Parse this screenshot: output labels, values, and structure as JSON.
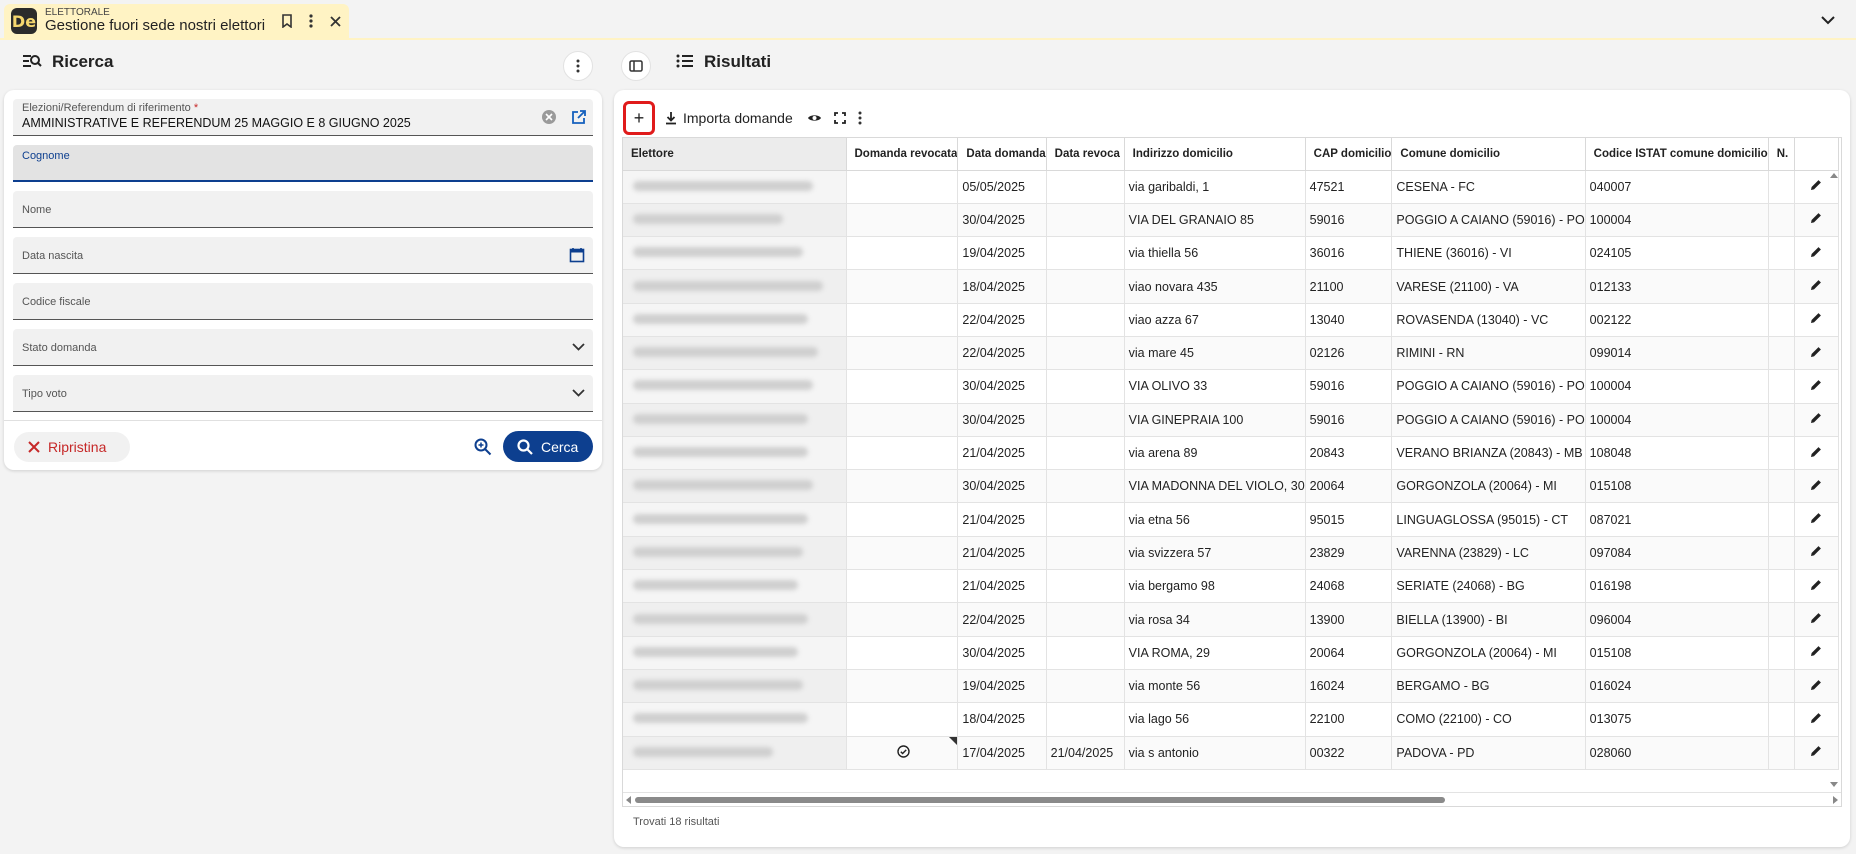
{
  "app": {
    "category": "ELETTORALE",
    "title": "Gestione fuori sede nostri elettori",
    "logo_text": "De"
  },
  "search_panel": {
    "title": "Ricerca",
    "fields": {
      "election": {
        "label": "Elezioni/Referendum di riferimento",
        "required_mark": "*",
        "value": "AMMINISTRATIVE E REFERENDUM 25 MAGGIO E 8 GIUGNO 2025"
      },
      "surname": {
        "label": "Cognome",
        "value": ""
      },
      "name": {
        "label": "Nome",
        "value": ""
      },
      "birth_date": {
        "label": "Data nascita",
        "value": ""
      },
      "tax_code": {
        "label": "Codice fiscale",
        "value": ""
      },
      "status": {
        "label": "Stato domanda",
        "value": ""
      },
      "vote_type": {
        "label": "Tipo voto",
        "value": ""
      }
    },
    "reset_label": "Ripristina",
    "search_label": "Cerca"
  },
  "results_panel": {
    "title": "Risultati",
    "toolbar": {
      "add": "+",
      "import_label": "Importa domande"
    },
    "columns": [
      "Elettore",
      "Domanda revocata",
      "Data domanda",
      "Data revoca",
      "Indirizzo domicilio",
      "CAP domicilio",
      "Comune domicilio",
      "Codice ISTAT comune domicilio",
      "N."
    ],
    "rows": [
      {
        "revoked": false,
        "date": "05/05/2025",
        "revoke_date": "",
        "address": "via garibaldi, 1",
        "cap": "47521",
        "city": "CESENA - FC",
        "istat": "040007"
      },
      {
        "revoked": false,
        "date": "30/04/2025",
        "revoke_date": "",
        "address": "VIA DEL GRANAIO 85",
        "cap": "59016",
        "city": "POGGIO A CAIANO (59016) - PO",
        "istat": "100004"
      },
      {
        "revoked": false,
        "date": "19/04/2025",
        "revoke_date": "",
        "address": "via thiella 56",
        "cap": "36016",
        "city": "THIENE (36016) - VI",
        "istat": "024105"
      },
      {
        "revoked": false,
        "date": "18/04/2025",
        "revoke_date": "",
        "address": "viao novara 435",
        "cap": "21100",
        "city": "VARESE (21100) - VA",
        "istat": "012133"
      },
      {
        "revoked": false,
        "date": "22/04/2025",
        "revoke_date": "",
        "address": "viao azza 67",
        "cap": "13040",
        "city": "ROVASENDA (13040) - VC",
        "istat": "002122"
      },
      {
        "revoked": false,
        "date": "22/04/2025",
        "revoke_date": "",
        "address": "via mare 45",
        "cap": "02126",
        "city": "RIMINI - RN",
        "istat": "099014"
      },
      {
        "revoked": false,
        "date": "30/04/2025",
        "revoke_date": "",
        "address": "VIA OLIVO 33",
        "cap": "59016",
        "city": "POGGIO A CAIANO (59016) - PO",
        "istat": "100004"
      },
      {
        "revoked": false,
        "date": "30/04/2025",
        "revoke_date": "",
        "address": "VIA GINEPRAIA 100",
        "cap": "59016",
        "city": "POGGIO A CAIANO (59016) - PO",
        "istat": "100004"
      },
      {
        "revoked": false,
        "date": "21/04/2025",
        "revoke_date": "",
        "address": "via arena 89",
        "cap": "20843",
        "city": "VERANO BRIANZA (20843) - MB",
        "istat": "108048"
      },
      {
        "revoked": false,
        "date": "30/04/2025",
        "revoke_date": "",
        "address": "VIA MADONNA DEL VIOLO, 30",
        "cap": "20064",
        "city": "GORGONZOLA (20064) - MI",
        "istat": "015108"
      },
      {
        "revoked": false,
        "date": "21/04/2025",
        "revoke_date": "",
        "address": "via etna 56",
        "cap": "95015",
        "city": "LINGUAGLOSSA (95015) - CT",
        "istat": "087021"
      },
      {
        "revoked": false,
        "date": "21/04/2025",
        "revoke_date": "",
        "address": "via svizzera 57",
        "cap": "23829",
        "city": "VARENNA (23829) - LC",
        "istat": "097084"
      },
      {
        "revoked": false,
        "date": "21/04/2025",
        "revoke_date": "",
        "address": "via bergamo 98",
        "cap": "24068",
        "city": "SERIATE (24068) - BG",
        "istat": "016198"
      },
      {
        "revoked": false,
        "date": "22/04/2025",
        "revoke_date": "",
        "address": "via rosa 34",
        "cap": "13900",
        "city": "BIELLA (13900) - BI",
        "istat": "096004"
      },
      {
        "revoked": false,
        "date": "30/04/2025",
        "revoke_date": "",
        "address": "VIA ROMA, 29",
        "cap": "20064",
        "city": "GORGONZOLA (20064) - MI",
        "istat": "015108"
      },
      {
        "revoked": false,
        "date": "19/04/2025",
        "revoke_date": "",
        "address": "via monte 56",
        "cap": "16024",
        "city": "BERGAMO - BG",
        "istat": "016024"
      },
      {
        "revoked": false,
        "date": "18/04/2025",
        "revoke_date": "",
        "address": "via lago 56",
        "cap": "22100",
        "city": "COMO (22100) - CO",
        "istat": "013075"
      },
      {
        "revoked": true,
        "date": "17/04/2025",
        "revoke_date": "21/04/2025",
        "address": "via s antonio",
        "cap": "00322",
        "city": "PADOVA - PD",
        "istat": "028060"
      }
    ],
    "footer": "Trovati 18 risultati"
  },
  "colors": {
    "accent": "#0d3f8f",
    "danger": "#c62828",
    "tab_bg": "#fff3c4",
    "highlight": "#e01b1b"
  }
}
